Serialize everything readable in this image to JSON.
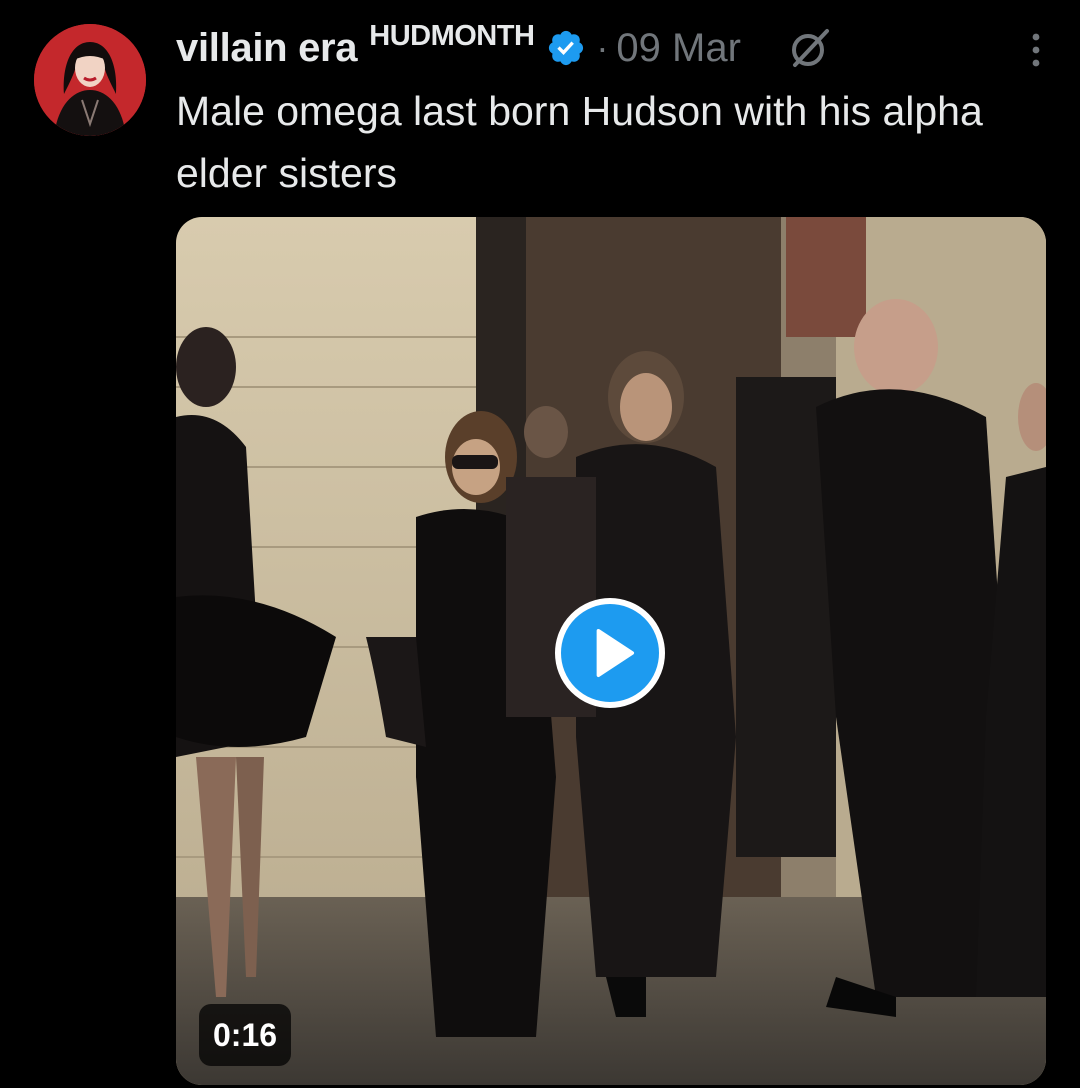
{
  "tweet": {
    "author": {
      "display_name": "villain era",
      "name_badge": "HUDMONTH",
      "verified": true
    },
    "separator": "·",
    "timestamp": "09 Mar",
    "text": "Male omega last born Hudson with his alpha elder sisters",
    "media": {
      "type": "video",
      "duration": "0:16"
    }
  },
  "icons": {
    "avatar": "user-avatar",
    "verified": "verified-badge-icon",
    "grok": "grok-icon",
    "more": "more-options-icon",
    "play": "play-icon"
  },
  "colors": {
    "background": "#000000",
    "text_primary": "#e7e9ea",
    "text_secondary": "#71767b",
    "accent": "#1d9bf0"
  }
}
